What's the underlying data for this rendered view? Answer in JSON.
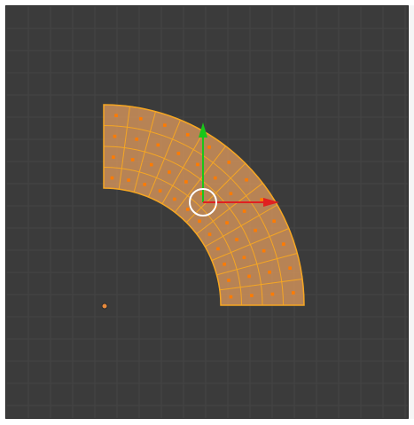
{
  "viewport": {
    "background_color": "#3b3b3b",
    "grid_color": "#444444",
    "mode": "edit"
  },
  "mesh": {
    "type": "curved-plane-quarter-arc",
    "selected": true,
    "fill_color": "#e8a060",
    "edge_color": "#f5a623",
    "vertex_color": "#ff7b00",
    "radial_segments": 4,
    "angular_segments": 12
  },
  "gizmo": {
    "x_axis_color": "#e02020",
    "y_axis_color": "#19c619",
    "pivot_ring_color": "#ffffff"
  },
  "origin_marker": {
    "color": "#e78a3c"
  }
}
